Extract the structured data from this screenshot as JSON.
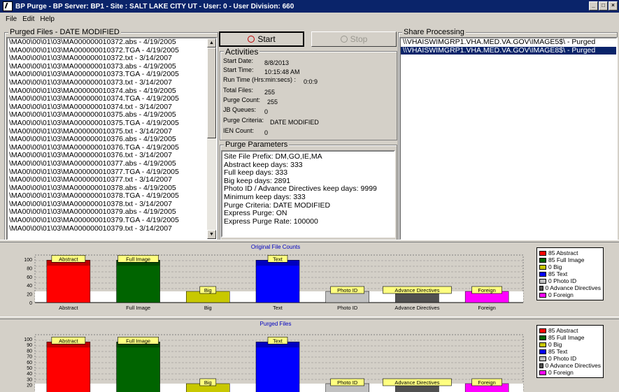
{
  "window": {
    "title": "BP Purge  -  BP Server: BP1  -  Site : SALT LAKE CITY UT  -  User: 0  -  User Division: 660"
  },
  "menu": [
    "File",
    "Edit",
    "Help"
  ],
  "purged_files": {
    "title": "Purged Files  -  DATE MODIFIED",
    "rows": [
      "\\MA00\\00\\01\\03\\MA000000010372.abs - 4/19/2005",
      "\\MA00\\00\\01\\03\\MA000000010372.TGA - 4/19/2005",
      "\\MA00\\00\\01\\03\\MA000000010372.txt - 3/14/2007",
      "\\MA00\\00\\01\\03\\MA000000010373.abs - 4/19/2005",
      "\\MA00\\00\\01\\03\\MA000000010373.TGA - 4/19/2005",
      "\\MA00\\00\\01\\03\\MA000000010373.txt - 3/14/2007",
      "\\MA00\\00\\01\\03\\MA000000010374.abs - 4/19/2005",
      "\\MA00\\00\\01\\03\\MA000000010374.TGA - 4/19/2005",
      "\\MA00\\00\\01\\03\\MA000000010374.txt - 3/14/2007",
      "\\MA00\\00\\01\\03\\MA000000010375.abs - 4/19/2005",
      "\\MA00\\00\\01\\03\\MA000000010375.TGA - 4/19/2005",
      "\\MA00\\00\\01\\03\\MA000000010375.txt - 3/14/2007",
      "\\MA00\\00\\01\\03\\MA000000010376.abs - 4/19/2005",
      "\\MA00\\00\\01\\03\\MA000000010376.TGA - 4/19/2005",
      "\\MA00\\00\\01\\03\\MA000000010376.txt - 3/14/2007",
      "\\MA00\\00\\01\\03\\MA000000010377.abs - 4/19/2005",
      "\\MA00\\00\\01\\03\\MA000000010377.TGA - 4/19/2005",
      "\\MA00\\00\\01\\03\\MA000000010377.txt - 3/14/2007",
      "\\MA00\\00\\01\\03\\MA000000010378.abs - 4/19/2005",
      "\\MA00\\00\\01\\03\\MA000000010378.TGA - 4/19/2005",
      "\\MA00\\00\\01\\03\\MA000000010378.txt - 3/14/2007",
      "\\MA00\\00\\01\\03\\MA000000010379.abs - 4/19/2005",
      "\\MA00\\00\\01\\03\\MA000000010379.TGA - 4/19/2005",
      "\\MA00\\00\\01\\03\\MA000000010379.txt - 3/14/2007"
    ]
  },
  "controls": {
    "start_label": "Start",
    "stop_label": "Stop"
  },
  "activities": {
    "title": "Activities",
    "start_date_label": "Start Date:",
    "start_date": "8/8/2013",
    "start_time_label": "Start Time:",
    "start_time": "10:15:48 AM",
    "run_time_label": "Run Time (Hrs:min:secs) :",
    "run_time": "0:0:9",
    "total_files_label": "Total Files:",
    "total_files": "255",
    "purge_count_label": "Purge Count:",
    "purge_count": "255",
    "jb_queues_label": "JB Queues:",
    "jb_queues": "0",
    "purge_criteria_label": "Purge Criteria:",
    "purge_criteria": "DATE MODIFIED",
    "ien_count_label": "IEN Count:",
    "ien_count": "0"
  },
  "purge_parameters": {
    "title": "Purge Parameters",
    "lines": [
      "Site File Prefix: DM,GO,IE,MA",
      "Abstract keep days: 333",
      "Full keep days: 333",
      "Big keep days: 2891",
      "Photo ID / Advance Directives keep days: 9999",
      "Minimum keep days: 333",
      "Purge Criteria: DATE MODIFIED",
      "Express Purge: ON",
      "Express Purge Rate: 100000"
    ]
  },
  "share_processing": {
    "title": "Share Processing",
    "rows": [
      "\\\\VHAISWIMGRP1.VHA.MED.VA.GOV\\IMAGE5$\\ - Purged",
      "\\\\VHAISWIMGRP1.VHA.MED.VA.GOV\\IMAGE8$\\ - Purged"
    ],
    "selected_index": 1
  },
  "colors": {
    "abstract": "#ff0000",
    "full": "#006400",
    "big": "#c8c800",
    "text": "#0000ff",
    "photo": "#c0c0c0",
    "advance": "#505050",
    "foreign": "#ff00ff"
  },
  "chart_data": [
    {
      "type": "bar",
      "title": "Original File Counts",
      "categories": [
        "Abstract",
        "Full Image",
        "Big",
        "Text",
        "Photo ID",
        "Advance Directives",
        "Foreign"
      ],
      "values": [
        85,
        85,
        0,
        85,
        0,
        0,
        0
      ],
      "yticks": [
        0,
        20,
        40,
        60,
        80,
        100
      ],
      "ylim": [
        0,
        100
      ],
      "legend": [
        "85 Abstract",
        "85 Full Image",
        "0 Big",
        "85 Text",
        "0 Photo ID",
        "0 Advance Directives",
        "0 Foreign"
      ],
      "legend_position": "right"
    },
    {
      "type": "bar",
      "title": "Purged Files",
      "categories": [
        "Abstract",
        "Full Image",
        "Big",
        "Text",
        "Photo ID",
        "Advance Directives",
        "Foreign"
      ],
      "values": [
        85,
        85,
        0,
        85,
        0,
        0,
        0
      ],
      "yticks": [
        20,
        30,
        40,
        50,
        60,
        70,
        80,
        90,
        100
      ],
      "ylim": [
        0,
        100
      ],
      "legend": [
        "85 Abstract",
        "85 Full Image",
        "0 Big",
        "85 Text",
        "0 Photo ID",
        "0 Advance Directives",
        "0 Foreign"
      ],
      "legend_position": "right"
    }
  ]
}
